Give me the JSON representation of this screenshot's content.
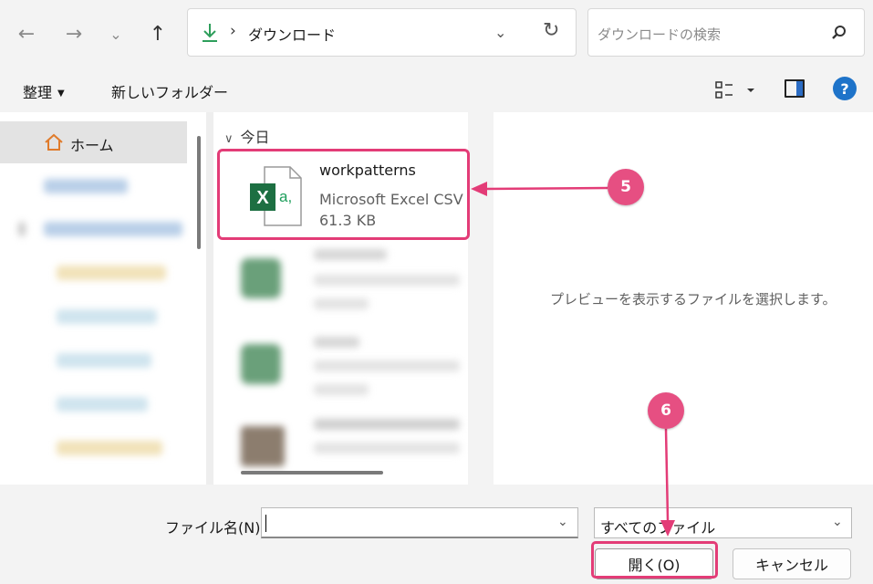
{
  "address_bar": {
    "breadcrumb_separator": "›",
    "current_folder": "ダウンロード",
    "search_placeholder": "ダウンロードの検索"
  },
  "command_bar": {
    "organize_label": "整理",
    "new_folder_label": "新しいフォルダー",
    "help_label": "?"
  },
  "nav_pane": {
    "home_label": "ホーム"
  },
  "file_list": {
    "group_header": "今日",
    "selected_file": {
      "name": "workpatterns",
      "type": "Microsoft Excel CSV ファ",
      "size": "61.3 KB",
      "icon_letter": "X",
      "icon_suffix": "a,"
    }
  },
  "preview": {
    "message": "プレビューを表示するファイルを選択します。"
  },
  "bottom_bar": {
    "file_name_label": "ファイル名(N):",
    "file_name_value": "",
    "file_type_filter": "すべてのファイル",
    "open_label": "開く(O)",
    "cancel_label": "キャンセル"
  },
  "annotations": {
    "step5": "5",
    "step6": "6",
    "highlight_color": "#e33c77"
  },
  "colors": {
    "excel_green": "#1d6f42",
    "accent_blue": "#1e73c9",
    "download_green": "#2e9e5b"
  }
}
